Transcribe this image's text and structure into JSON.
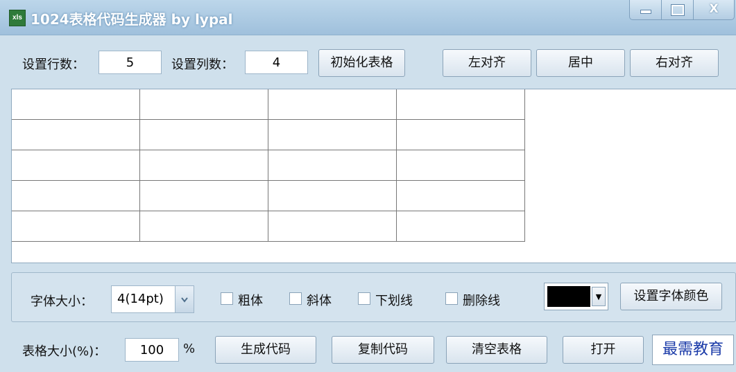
{
  "window": {
    "title": "1024表格代码生成器    by  lypal",
    "icon": "spreadsheet-app-icon",
    "minimize": "minimize",
    "maximize": "maximize",
    "close": "X"
  },
  "toolbar": {
    "rows_label": "设置行数：",
    "rows_value": "5",
    "cols_label": "设置列数：",
    "cols_value": "4",
    "init_button": "初始化表格",
    "align_left": "左对齐",
    "align_center": "居中",
    "align_right": "右对齐"
  },
  "table_preview": {
    "rows": 5,
    "columns": 4
  },
  "font_panel": {
    "size_label": "字体大小：",
    "size_value": "4(14pt)",
    "bold": "粗体",
    "italic": "斜体",
    "underline": "下划线",
    "strikethrough": "删除线",
    "color_value": "#000000",
    "set_color_button": "设置字体颜色"
  },
  "bottom": {
    "table_size_label": "表格大小(%)：",
    "table_size_value": "100",
    "percent": "%",
    "generate": "生成代码",
    "copy": "复制代码",
    "clear": "清空表格",
    "open": "打开",
    "watermark": "最需教育"
  }
}
